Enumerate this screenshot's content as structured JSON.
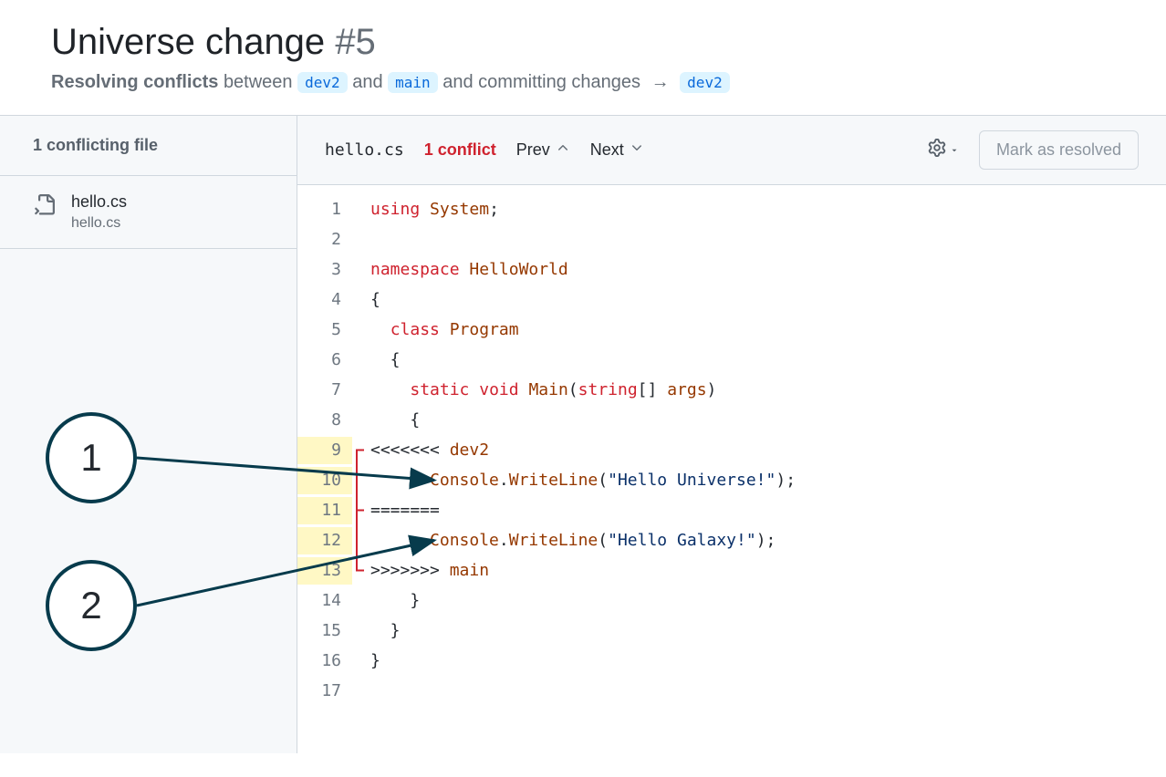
{
  "header": {
    "title": "Universe change",
    "pr_number": "#5",
    "resolving_label": "Resolving conflicts",
    "between_label": "between",
    "from_branch": "dev2",
    "and_label": "and",
    "to_branch": "main",
    "committing_label": "and committing changes",
    "target_branch": "dev2"
  },
  "sidebar": {
    "header": "1 conflicting file",
    "file": {
      "title": "hello.cs",
      "path": "hello.cs"
    }
  },
  "toolbar": {
    "filename": "hello.cs",
    "conflict_count": "1 conflict",
    "prev": "Prev",
    "next": "Next",
    "resolve_label": "Mark as resolved"
  },
  "code": {
    "lines": [
      {
        "n": "1",
        "hl": false,
        "tokens": [
          {
            "t": "kw",
            "v": "using"
          },
          {
            "t": "op",
            "v": " "
          },
          {
            "t": "typ",
            "v": "System"
          },
          {
            "t": "op",
            "v": ";"
          }
        ]
      },
      {
        "n": "2",
        "hl": false,
        "tokens": []
      },
      {
        "n": "3",
        "hl": false,
        "tokens": [
          {
            "t": "kw",
            "v": "namespace"
          },
          {
            "t": "op",
            "v": " "
          },
          {
            "t": "typ",
            "v": "HelloWorld"
          }
        ]
      },
      {
        "n": "4",
        "hl": false,
        "tokens": [
          {
            "t": "op",
            "v": "{"
          }
        ]
      },
      {
        "n": "5",
        "hl": false,
        "tokens": [
          {
            "t": "op",
            "v": "  "
          },
          {
            "t": "kw",
            "v": "class"
          },
          {
            "t": "op",
            "v": " "
          },
          {
            "t": "typ",
            "v": "Program"
          }
        ]
      },
      {
        "n": "6",
        "hl": false,
        "tokens": [
          {
            "t": "op",
            "v": "  {"
          }
        ]
      },
      {
        "n": "7",
        "hl": false,
        "tokens": [
          {
            "t": "op",
            "v": "    "
          },
          {
            "t": "kw",
            "v": "static"
          },
          {
            "t": "op",
            "v": " "
          },
          {
            "t": "kw",
            "v": "void"
          },
          {
            "t": "op",
            "v": " "
          },
          {
            "t": "typ",
            "v": "Main"
          },
          {
            "t": "op",
            "v": "("
          },
          {
            "t": "kw",
            "v": "string"
          },
          {
            "t": "op",
            "v": "[] "
          },
          {
            "t": "typ",
            "v": "args"
          },
          {
            "t": "op",
            "v": ")"
          }
        ]
      },
      {
        "n": "8",
        "hl": false,
        "tokens": [
          {
            "t": "op",
            "v": "    {"
          }
        ]
      },
      {
        "n": "9",
        "hl": true,
        "tokens": [
          {
            "t": "op",
            "v": "<<<<<<< "
          },
          {
            "t": "typ",
            "v": "dev2"
          }
        ]
      },
      {
        "n": "10",
        "hl": true,
        "tokens": [
          {
            "t": "op",
            "v": "      "
          },
          {
            "t": "typ",
            "v": "Console"
          },
          {
            "t": "op",
            "v": "."
          },
          {
            "t": "typ",
            "v": "WriteLine"
          },
          {
            "t": "op",
            "v": "("
          },
          {
            "t": "str",
            "v": "\"Hello Universe!\""
          },
          {
            "t": "op",
            "v": ");"
          }
        ]
      },
      {
        "n": "11",
        "hl": true,
        "tokens": [
          {
            "t": "op",
            "v": "======="
          }
        ]
      },
      {
        "n": "12",
        "hl": true,
        "tokens": [
          {
            "t": "op",
            "v": "      "
          },
          {
            "t": "typ",
            "v": "Console"
          },
          {
            "t": "op",
            "v": "."
          },
          {
            "t": "typ",
            "v": "WriteLine"
          },
          {
            "t": "op",
            "v": "("
          },
          {
            "t": "str",
            "v": "\"Hello Galaxy!\""
          },
          {
            "t": "op",
            "v": ");"
          }
        ]
      },
      {
        "n": "13",
        "hl": true,
        "tokens": [
          {
            "t": "op",
            "v": ">>>>>>> "
          },
          {
            "t": "typ",
            "v": "main"
          }
        ]
      },
      {
        "n": "14",
        "hl": false,
        "tokens": [
          {
            "t": "op",
            "v": "    }"
          }
        ]
      },
      {
        "n": "15",
        "hl": false,
        "tokens": [
          {
            "t": "op",
            "v": "  }"
          }
        ]
      },
      {
        "n": "16",
        "hl": false,
        "tokens": [
          {
            "t": "op",
            "v": "}"
          }
        ]
      },
      {
        "n": "17",
        "hl": false,
        "tokens": []
      }
    ]
  },
  "callouts": {
    "one": "1",
    "two": "2"
  }
}
